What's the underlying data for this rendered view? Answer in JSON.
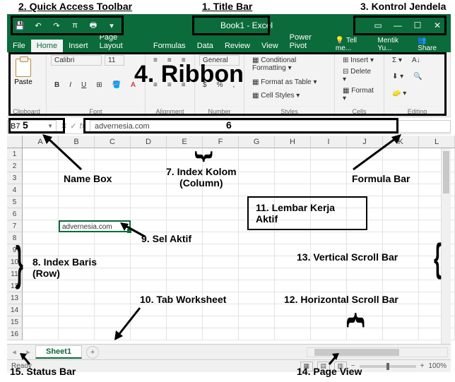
{
  "annotations": {
    "a1": "1. Title Bar",
    "a2": "2. Quick Access Toolbar",
    "a3": "3. Kontrol Jendela",
    "a4": "4. Ribbon",
    "a5": "5",
    "a6": "6",
    "a7": "7. Index Kolom\n(Column)",
    "a8": "8. Index Baris\n(Row)",
    "a9": "9. Sel Aktif",
    "a10": "10. Tab Worksheet",
    "a11": "11. Lembar Kerja Aktif",
    "a12": "12. Horizontal Scroll Bar",
    "a13": "13. Vertical Scroll Bar",
    "a14": "14. Page View",
    "a15": "15. Status Bar",
    "namebox_label": "Name Box",
    "formulabar_label": "Formula Bar"
  },
  "title": "Book1 - Excel",
  "qat": [
    "💾",
    "↶",
    "↷",
    "π",
    "🖶",
    "▾"
  ],
  "winctrl_icons": [
    "▭",
    "—",
    "☐",
    "✕"
  ],
  "tabs": [
    "File",
    "Home",
    "Insert",
    "Page Layout",
    "Formulas",
    "Data",
    "Review",
    "View",
    "Power Pivot"
  ],
  "tabs_right": {
    "tellme": "Tell me...",
    "user": "Mentik Yu...",
    "share": "Share"
  },
  "ribbon": {
    "clipboard": {
      "paste": "Paste",
      "label": "Clipboard"
    },
    "font": {
      "name": "Calibri",
      "size": "11",
      "label": "Font"
    },
    "alignment": {
      "label": "Alignment"
    },
    "number": {
      "format": "General",
      "label": "Number"
    },
    "styles": {
      "cf": "Conditional Formatting",
      "fat": "Format as Table",
      "cs": "Cell Styles",
      "label": "Styles"
    },
    "cells": {
      "ins": "Insert",
      "del": "Delete",
      "fmt": "Format",
      "label": "Cells"
    },
    "editing": {
      "label": "Editing"
    }
  },
  "namebox": "B7",
  "formula": "advernesia.com",
  "columns": [
    "A",
    "B",
    "C",
    "D",
    "E",
    "F",
    "G",
    "H",
    "I",
    "J",
    "K",
    "L"
  ],
  "rows": [
    "1",
    "2",
    "3",
    "4",
    "5",
    "6",
    "7",
    "8",
    "9",
    "10",
    "11",
    "12",
    "13",
    "14",
    "15",
    "16"
  ],
  "active_cell_value": "advernesia.com",
  "sheet_tab": "Sheet1",
  "status_ready": "Ready",
  "zoom": "100%"
}
